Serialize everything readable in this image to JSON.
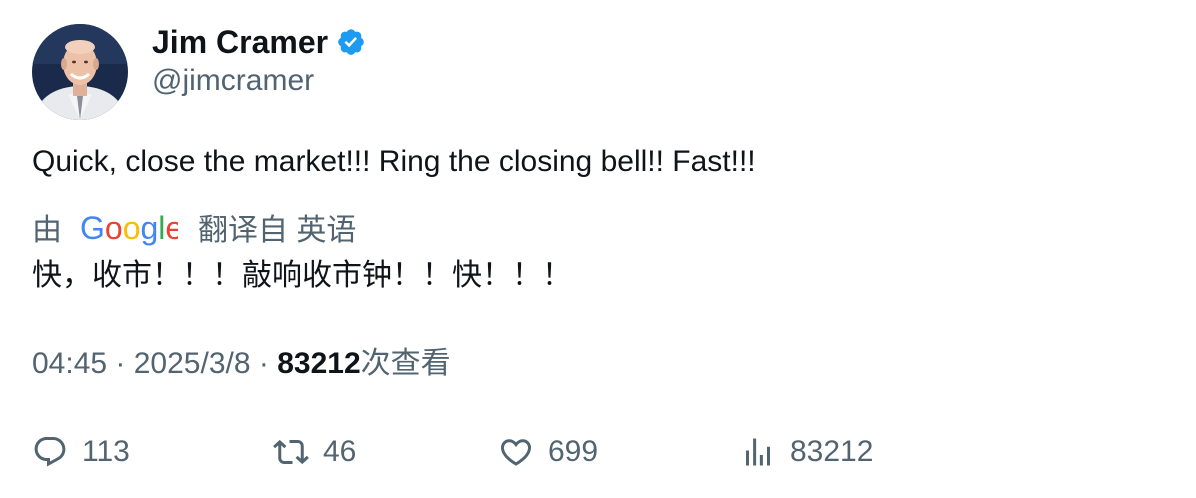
{
  "author": {
    "display_name": "Jim Cramer",
    "handle": "@jimcramer",
    "verified": true
  },
  "tweet": {
    "text": "Quick, close the market!!! Ring the closing bell!! Fast!!!",
    "translation_prefix": "由",
    "translation_provider": "Google",
    "translation_suffix": "翻译自 英语",
    "translated_text": "快，收市！！！敲响收市钟！！快！！！"
  },
  "meta": {
    "time": "04:45",
    "separator": " · ",
    "date": "2025/3/8",
    "views_count": "83212",
    "views_label": "次查看"
  },
  "actions": {
    "replies": "113",
    "retweets": "46",
    "likes": "699",
    "views": "83212"
  },
  "colors": {
    "primary_text": "#0f1419",
    "secondary_text": "#536471",
    "verified_blue": "#1d9bf0"
  }
}
